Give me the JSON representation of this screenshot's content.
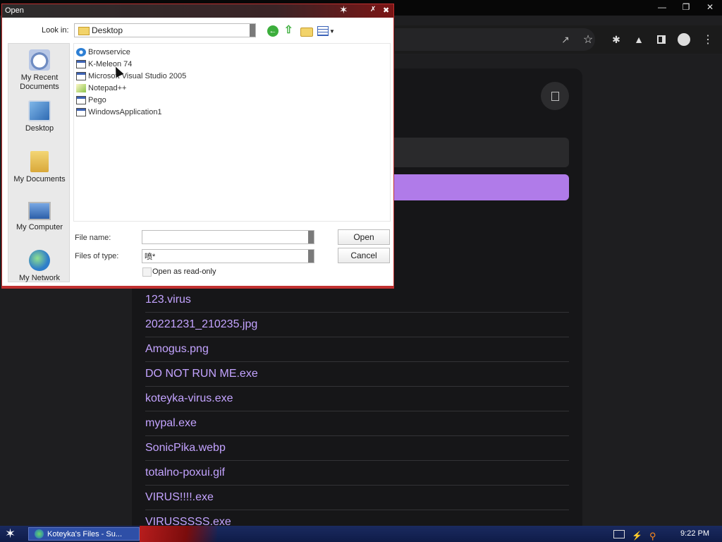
{
  "browser": {
    "window_controls": [
      "minimize",
      "restore",
      "close"
    ],
    "toolbar_icons": [
      "share-icon",
      "star-icon",
      "extensions-icon",
      "labs-icon",
      "sidebar-icon",
      "profile-icon",
      "menu-icon"
    ]
  },
  "page": {
    "files": [
      "123.virus",
      "20221231_210235.jpg",
      "Amogus.png",
      "DO NOT RUN ME.exe",
      "koteyka-virus.exe",
      "mypal.exe",
      "SonicPika.webp",
      "totalno-poxui.gif",
      "VIRUS!!!!.exe",
      "VIRUSSSSS.exe"
    ],
    "accent_color": "#b07be9"
  },
  "dialog": {
    "title": "Open",
    "look_in_label": "Look in:",
    "look_in_value": "Desktop",
    "places": [
      "My Recent Documents",
      "Desktop",
      "My Documents",
      "My Computer",
      "My Network"
    ],
    "files": [
      "Browservice",
      "K-Meleon 74",
      "Microsoft Visual Studio 2005",
      "Notepad++",
      "Pego",
      "WindowsApplication1"
    ],
    "file_name_label": "File name:",
    "file_name_value": "",
    "files_of_type_label": "Files of type:",
    "files_of_type_value": "喷*",
    "open_button": "Open",
    "cancel_button": "Cancel",
    "read_only_label": "Open as read-only"
  },
  "taskbar": {
    "task_label": "Koteyka's Files - Su...",
    "clock": "9:22 PM"
  }
}
